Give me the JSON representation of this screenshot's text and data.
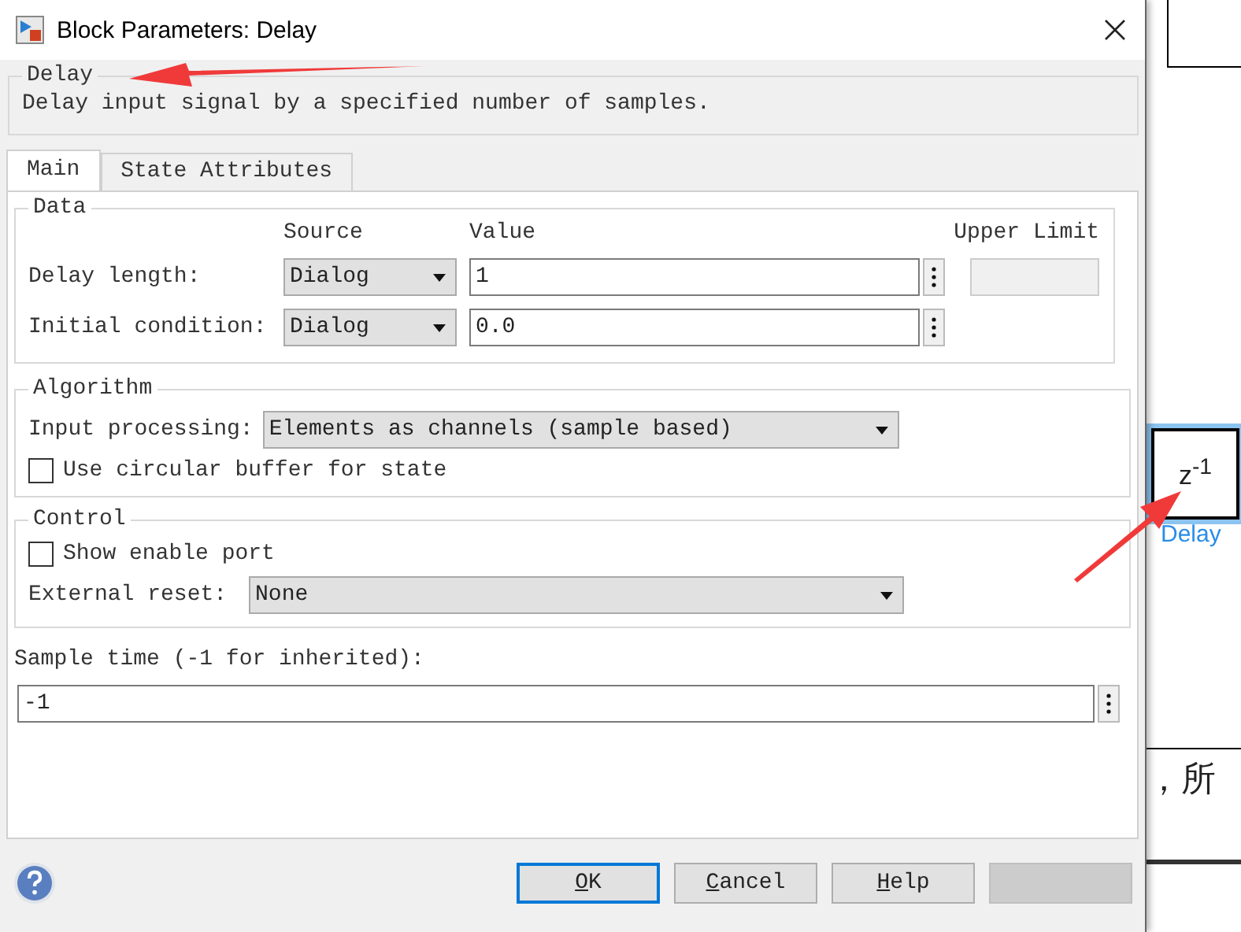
{
  "window": {
    "title": "Block Parameters: Delay"
  },
  "description": {
    "title": "Delay",
    "text": "Delay input signal by a specified number of samples."
  },
  "tabs": [
    {
      "label": "Main",
      "selected": true
    },
    {
      "label": "State Attributes",
      "selected": false
    }
  ],
  "data_group": {
    "title": "Data",
    "columns": [
      "Source",
      "Value",
      "Upper Limit"
    ],
    "rows": [
      {
        "label": "Delay length:",
        "source": "Dialog",
        "value": "1",
        "upper_limit_field": true
      },
      {
        "label": "Initial condition:",
        "source": "Dialog",
        "value": "0.0",
        "upper_limit_field": false
      }
    ]
  },
  "algorithm_group": {
    "title": "Algorithm",
    "input_processing": {
      "label": "Input processing:",
      "value": "Elements as channels (sample based)"
    },
    "circular_buffer": {
      "label": "Use circular buffer for state",
      "checked": false
    }
  },
  "control_group": {
    "title": "Control",
    "enable_port": {
      "label": "Show enable port",
      "checked": false
    },
    "external_reset": {
      "label": "External reset:",
      "value": "None"
    }
  },
  "sample_time": {
    "label": "Sample time (-1 for inherited):",
    "value": "-1"
  },
  "buttons": [
    {
      "label": "OK",
      "default": true,
      "disabled": false
    },
    {
      "label": "Cancel",
      "default": false,
      "disabled": false
    },
    {
      "label": "Help",
      "default": false,
      "disabled": false
    },
    {
      "default": false,
      "disabled": true
    }
  ],
  "canvas": {
    "block": {
      "label": "z$^{-1}$",
      "name": "Delay",
      "selected": true
    },
    "text_fragment": "，所"
  }
}
